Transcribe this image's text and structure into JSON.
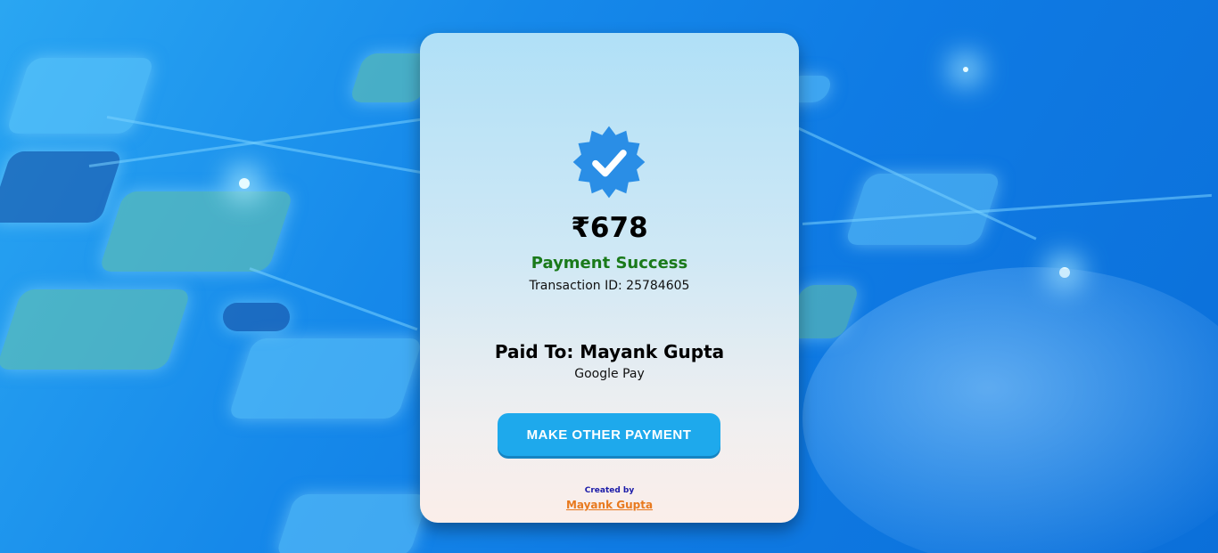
{
  "payment": {
    "amount": "₹678",
    "status": "Payment Success",
    "transaction_label": "Transaction ID: ",
    "transaction_id": "25784605",
    "paid_to_label": "Paid To: ",
    "payee_name": "Mayank Gupta",
    "method": "Google Pay"
  },
  "actions": {
    "make_payment_label": "MAKE OTHER PAYMENT"
  },
  "footer": {
    "created_by_label": "Created by",
    "author_name": "Mayank Gupta"
  },
  "icons": {
    "badge": "verified-check-icon"
  },
  "colors": {
    "status": "#1a7a1a",
    "button": "#1ea9ec",
    "badge": "#2a8ee6",
    "author": "#e8791e"
  }
}
